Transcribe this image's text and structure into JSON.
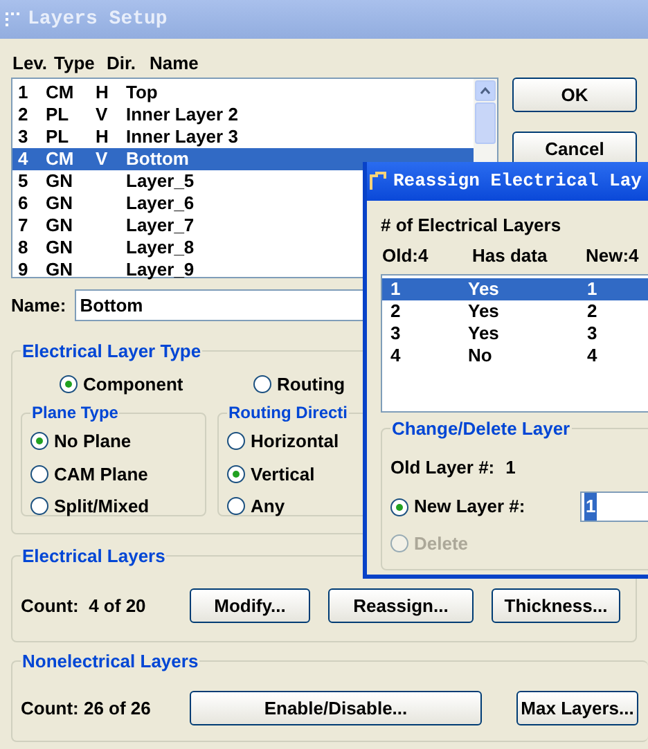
{
  "main_window": {
    "title": "Layers Setup"
  },
  "layer_list": {
    "columns": [
      "Lev.",
      "Type",
      "Dir.",
      "Name"
    ],
    "rows": [
      {
        "level": "1",
        "type": "CM",
        "dir": "H",
        "name": "Top",
        "selected": false
      },
      {
        "level": "2",
        "type": "PL",
        "dir": "V",
        "name": "Inner Layer 2",
        "selected": false
      },
      {
        "level": "3",
        "type": "PL",
        "dir": "H",
        "name": "Inner Layer 3",
        "selected": false
      },
      {
        "level": "4",
        "type": "CM",
        "dir": "V",
        "name": "Bottom",
        "selected": true
      },
      {
        "level": "5",
        "type": "GN",
        "name": "Layer_5",
        "selected": false
      },
      {
        "level": "6",
        "type": "GN",
        "name": "Layer_6",
        "selected": false
      },
      {
        "level": "7",
        "type": "GN",
        "name": "Layer_7",
        "selected": false
      },
      {
        "level": "8",
        "type": "GN",
        "name": "Layer_8",
        "selected": false
      },
      {
        "level": "9",
        "type": "GN",
        "name": "Layer_9",
        "selected": false
      }
    ]
  },
  "dialog_buttons": [
    "OK",
    "Cancel"
  ],
  "name_field": {
    "label": "Name:",
    "value": "Bottom"
  },
  "electrical_layer_type": {
    "title": "Electrical  Layer Type",
    "options": [
      {
        "label": "Component",
        "checked": true
      },
      {
        "label": "Routing",
        "checked": false
      }
    ]
  },
  "plane_type": {
    "title": "Plane Type",
    "options": [
      {
        "label": "No Plane",
        "checked": true
      },
      {
        "label": "CAM Plane",
        "checked": false
      },
      {
        "label": "Split/Mixed",
        "checked": false
      }
    ]
  },
  "routing_direction": {
    "title": "Routing Directi",
    "options": [
      {
        "label": "Horizontal",
        "checked": false
      },
      {
        "label": "Vertical",
        "checked": true
      },
      {
        "label": "Any",
        "checked": false
      }
    ]
  },
  "electrical_layers": {
    "title": "Electrical Layers",
    "count": "Count:  4 of 20",
    "buttons": [
      "Modify...",
      "Reassign...",
      "Thickness..."
    ]
  },
  "nonelectrical_layers": {
    "title": "Nonelectrical Layers",
    "count": "Count: 26 of 26",
    "buttons": [
      "Enable/Disable...",
      "Max Layers..."
    ]
  },
  "reassign_dialog": {
    "title": "Reassign Electrical Lay",
    "heading": "# of Electrical Layers",
    "columns": [
      "Old:4",
      "Has data",
      "New:4"
    ],
    "rows": [
      {
        "old": "1",
        "has_data": "Yes",
        "new": "1",
        "selected": true
      },
      {
        "old": "2",
        "has_data": "Yes",
        "new": "2",
        "selected": false
      },
      {
        "old": "3",
        "has_data": "Yes",
        "new": "3",
        "selected": false
      },
      {
        "old": "4",
        "has_data": "No",
        "new": "4",
        "selected": false
      }
    ],
    "change_group": {
      "title": "Change/Delete Layer",
      "old_layer_label": "Old Layer #:",
      "old_layer_value": "1",
      "new_layer": {
        "label": "New Layer #:",
        "checked": true,
        "value": "1"
      },
      "delete": {
        "label": "Delete",
        "checked": false,
        "disabled": true
      }
    }
  }
}
